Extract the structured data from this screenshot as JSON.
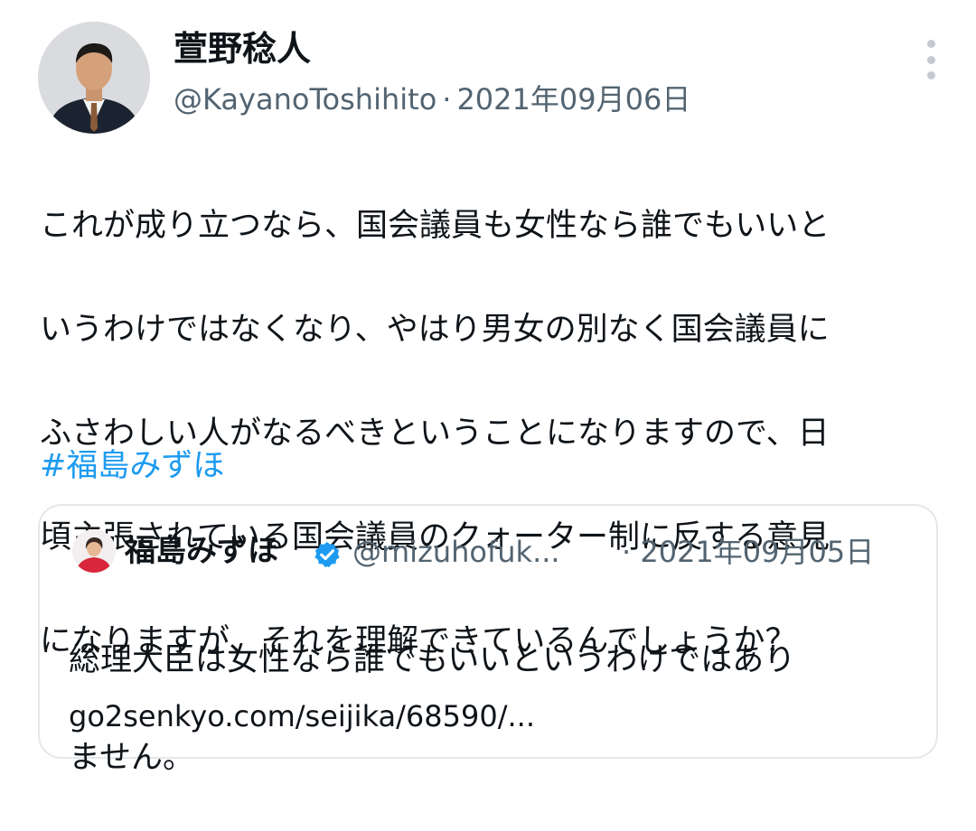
{
  "tweet": {
    "author_name": "萱野稔人",
    "handle": "@KayanoToshihito",
    "separator": "·",
    "date": "2021年09月06日",
    "body_lines": [
      "これが成り立つなら、国会議員も女性なら誰でもいいと",
      "いうわけではなくなり、やはり男女の別なく国会議員に",
      "ふさわしい人がなるべきということになりますので、日",
      "頃主張されている国会議員のクォーター制に反する意見",
      "になりますが、それを理解できているんでしょうか？"
    ],
    "hashtag": "#福島みずほ"
  },
  "quoted": {
    "author_name": "福島みずほ",
    "handle": "@mizuhofuk...",
    "separator": "·",
    "date": "2021年09月05日",
    "text_lines": [
      "総理大臣は女性なら誰でもいいというわけではあり",
      "ません。"
    ],
    "link": "go2senkyo.com/seijika/68590/..."
  },
  "icons": {
    "more": "more-vertical-icon",
    "verified": "verified-badge-icon"
  },
  "colors": {
    "text": "#0f1419",
    "secondary": "#536471",
    "link": "#1d9bf0",
    "verified": "#1d9bf0",
    "border": "#e4e8eb"
  }
}
